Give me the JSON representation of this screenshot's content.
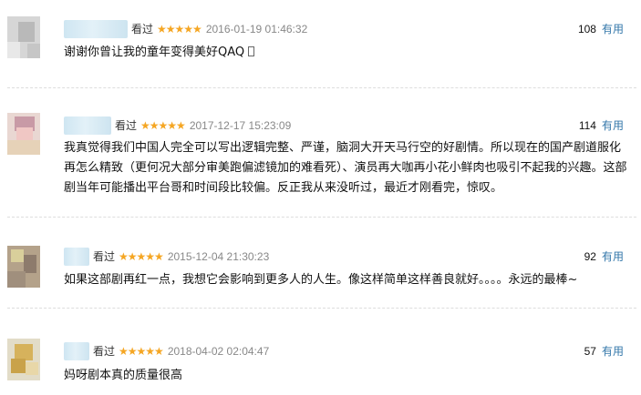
{
  "comments": [
    {
      "status": "看过",
      "stars": "★★★★★",
      "time": "2016-01-19 01:46:32",
      "votes": "108",
      "useful_label": "有用",
      "content": "谢谢你曾让我的童年变得美好QAQ"
    },
    {
      "status": "看过",
      "stars": "★★★★★",
      "time": "2017-12-17 15:23:09",
      "votes": "114",
      "useful_label": "有用",
      "content": "我真觉得我们中国人完全可以写出逻辑完整、严谨，脑洞大开天马行空的好剧情。所以现在的国产剧道服化再怎么精致（更何况大部分审美跑偏滤镜加的难看死）、演员再大咖再小花小鲜肉也吸引不起我的兴趣。这部剧当年可能播出平台哥和时间段比较偏。反正我从来没听过，最近才刚看完，惊叹。"
    },
    {
      "status": "看过",
      "stars": "★★★★★",
      "time": "2015-12-04 21:30:23",
      "votes": "92",
      "useful_label": "有用",
      "content": "如果这部剧再红一点，我想它会影响到更多人的人生。像这样简单这样善良就好。。。。永远的最棒~"
    },
    {
      "status": "看过",
      "stars": "★★★★★",
      "time": "2018-04-02 02:04:47",
      "votes": "57",
      "useful_label": "有用",
      "content": "妈呀剧本真的质量很高"
    }
  ],
  "colors": {
    "star": "#f5a623",
    "link": "#3377aa",
    "time": "#888888"
  }
}
